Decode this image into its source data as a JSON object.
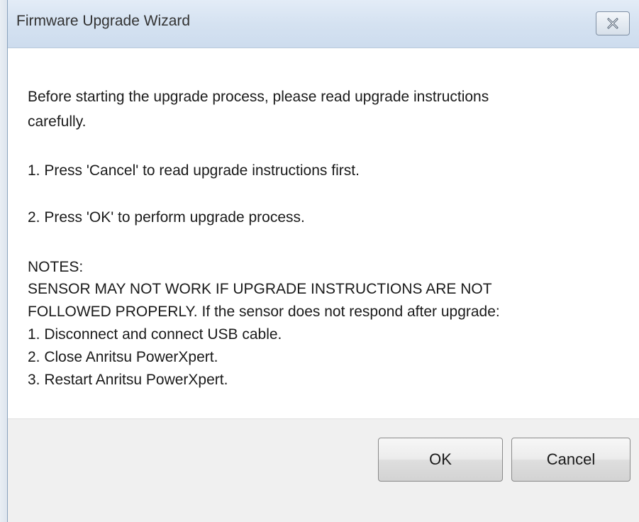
{
  "window": {
    "title": "Firmware Upgrade Wizard",
    "close_icon": "close-icon"
  },
  "message": {
    "intro_line1": "Before starting the upgrade process, please read upgrade instructions",
    "intro_line2": "carefully.",
    "step1": "1. Press 'Cancel' to read upgrade instructions first.",
    "step2": "2. Press 'OK' to perform upgrade process.",
    "notes_heading": "NOTES:",
    "notes_line1": "SENSOR MAY NOT WORK IF UPGRADE INSTRUCTIONS ARE NOT",
    "notes_line2": "FOLLOWED PROPERLY. If the sensor does not respond after upgrade:",
    "notes_item1": "1. Disconnect and connect USB cable.",
    "notes_item2": "2. Close Anritsu PowerXpert.",
    "notes_item3": "3. Restart Anritsu PowerXpert."
  },
  "buttons": {
    "ok_label": "OK",
    "cancel_label": "Cancel"
  }
}
